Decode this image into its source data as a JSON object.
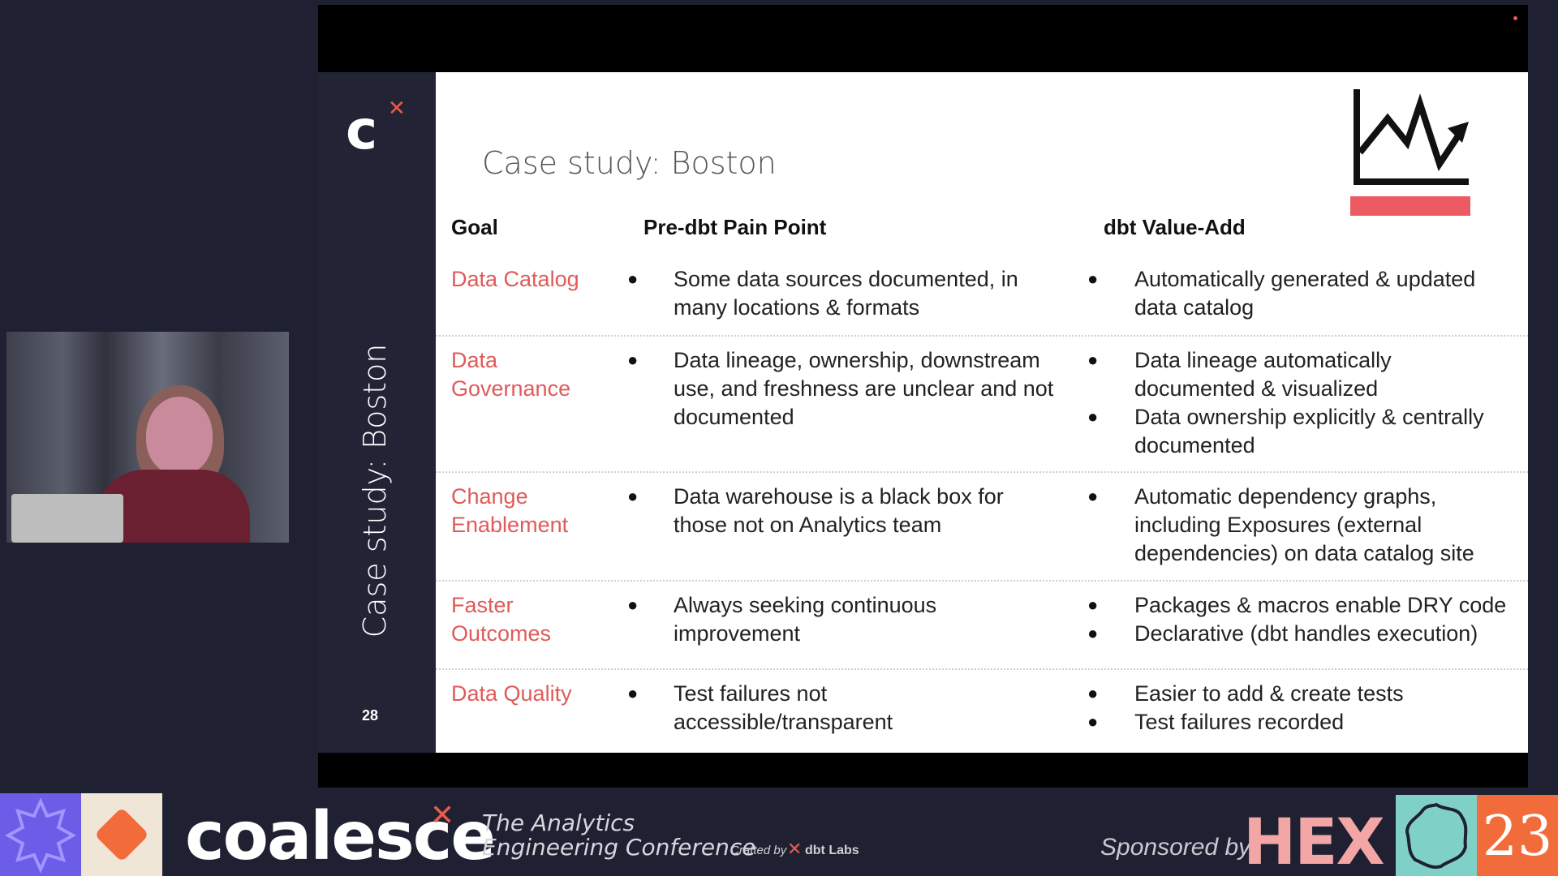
{
  "slide": {
    "title": "Case study: Boston",
    "vertical_title": "Case study: Boston",
    "page_number": "28",
    "logo_letter": "c",
    "columns": [
      "Goal",
      "Pre-dbt Pain Point",
      "dbt Value-Add"
    ],
    "rows": [
      {
        "goal": "Data Catalog",
        "pain": [
          "Some data sources documented, in many locations & formats"
        ],
        "value": [
          "Automatically generated & updated data catalog"
        ]
      },
      {
        "goal": "Data Governance",
        "pain": [
          "Data lineage, ownership, downstream use, and freshness are unclear and not documented"
        ],
        "value": [
          "Data lineage automatically documented & visualized",
          "Data ownership explicitly & centrally documented"
        ]
      },
      {
        "goal": "Change Enablement",
        "pain": [
          "Data warehouse is a black box for those not on Analytics team"
        ],
        "value": [
          "Automatic dependency graphs, including Exposures (external dependencies) on data catalog site"
        ]
      },
      {
        "goal": "Faster Outcomes",
        "pain": [
          "Always seeking continuous improvement"
        ],
        "value": [
          "Packages & macros enable DRY code",
          "Declarative (dbt handles execution)"
        ]
      },
      {
        "goal": "Data Quality",
        "pain": [
          "Test failures not accessible/transparent"
        ],
        "value": [
          "Easier to add & create tests",
          "Test failures recorded"
        ]
      }
    ],
    "accent_color": "#e05a5a",
    "bullet_char": "●"
  },
  "footer": {
    "brand": "coalesce",
    "tagline_line1": "The Analytics",
    "tagline_line2": "Engineering Conference",
    "crafted_by": "Crafted by",
    "dbt_labs": "dbt Labs",
    "sponsored_by": "Sponsored by",
    "sponsor": "HEX",
    "year": "23"
  },
  "icons": {
    "chart": "trending-chart-icon",
    "star_badge": "star-badge-icon",
    "diamond": "diamond-icon",
    "seal": "seal-icon"
  }
}
